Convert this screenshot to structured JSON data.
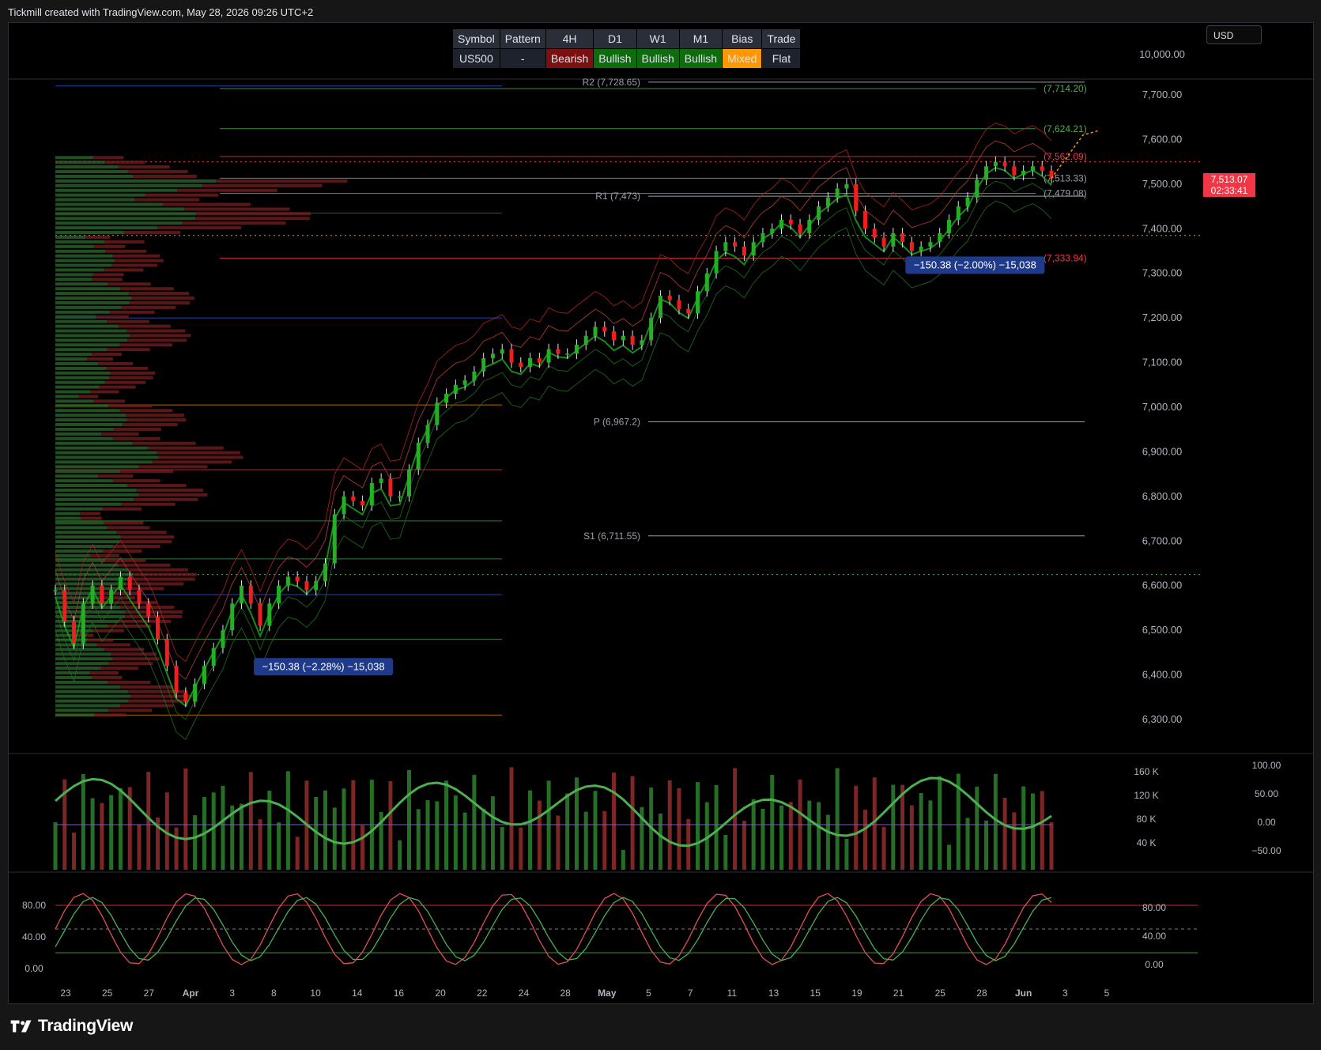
{
  "header": {
    "title": "Tickmill created with TradingView.com, May 28, 2026 09:26 UTC+2"
  },
  "currency": "USD",
  "bias_table": {
    "headers": [
      "Symbol",
      "Pattern",
      "4H",
      "D1",
      "W1",
      "M1",
      "Bias",
      "Trade"
    ],
    "values": [
      "US500",
      "-",
      "Bearish",
      "Bullish",
      "Bullish",
      "Bullish",
      "Mixed",
      "Flat"
    ],
    "colors": [
      "#1e222d",
      "#1e222d",
      "#7a1010",
      "#0e6b0e",
      "#0e6b0e",
      "#0e6b0e",
      "#ff9800",
      "#1e222d"
    ]
  },
  "last_price": {
    "value": "7,513.07",
    "countdown": "02:33:41"
  },
  "footer": {
    "brand": "TradingView"
  },
  "chart_data": [
    {
      "type": "line",
      "symbol": "US500",
      "ylim": [
        6260,
        7760
      ],
      "yticks_main": [
        "7,700.00",
        "7,600.00",
        "7,500.00",
        "7,400.00",
        "7,300.00",
        "7,200.00",
        "7,100.00",
        "7,000.00",
        "6,900.00",
        "6,800.00",
        "6,700.00",
        "6,600.00",
        "6,500.00",
        "6,400.00",
        "6,300.00"
      ],
      "ytick_top": "10,000.00",
      "x_ticks": [
        "23",
        "25",
        "27",
        "Apr",
        "3",
        "8",
        "10",
        "14",
        "16",
        "20",
        "22",
        "24",
        "28",
        "May",
        "5",
        "7",
        "11",
        "13",
        "15",
        "19",
        "21",
        "25",
        "28",
        "Jun",
        "3",
        "5"
      ],
      "series": [
        {
          "values": [
            6590,
            6520,
            6470,
            6560,
            6600,
            6560,
            6590,
            6620,
            6590,
            6560,
            6530,
            6480,
            6420,
            6360,
            6340,
            6380,
            6420,
            6460,
            6500,
            6560,
            6600,
            6560,
            6510,
            6560,
            6600,
            6620,
            6610,
            6590,
            6610,
            6650,
            6760,
            6800,
            6790,
            6780,
            6830,
            6840,
            6800,
            6800,
            6860,
            6920,
            6960,
            7010,
            7030,
            7050,
            7060,
            7080,
            7110,
            7120,
            7130,
            7100,
            7090,
            7110,
            7100,
            7130,
            7120,
            7120,
            7140,
            7160,
            7180,
            7170,
            7150,
            7160,
            7140,
            7150,
            7200,
            7250,
            7240,
            7220,
            7210,
            7260,
            7300,
            7350,
            7370,
            7360,
            7340,
            7370,
            7390,
            7400,
            7420,
            7410,
            7390,
            7420,
            7450,
            7470,
            7490,
            7500,
            7440,
            7400,
            7380,
            7360,
            7390,
            7370,
            7350,
            7360,
            7370,
            7390,
            7420,
            7450,
            7470,
            7510,
            7540,
            7550,
            7540,
            7520,
            7530,
            7540,
            7530,
            7513
          ]
        }
      ],
      "levels": [
        {
          "label": "R2 (7,728.65)",
          "price": 7728.65
        },
        {
          "label": "R1 (7,473)",
          "price": 7473
        },
        {
          "label": "P (6,967.2)",
          "price": 6967.2
        },
        {
          "label": "S1 (6,711.55)",
          "price": 6711.55
        }
      ],
      "right_labels": [
        {
          "label": "(7,714.20)",
          "price": 7714.2
        },
        {
          "label": "(7,624.21)",
          "price": 7624.21
        },
        {
          "label": "(7,562.09)",
          "price": 7562.09
        },
        {
          "label": "(7,513.33)",
          "price": 7513.33
        },
        {
          "label": "(7,479.08)",
          "price": 7479.08
        },
        {
          "label": "(7,333.94)",
          "price": 7333.94
        }
      ],
      "annotations": [
        {
          "label": "−150.38 (−2.28%) −15,038",
          "x_index": 22,
          "price": 6420
        },
        {
          "label": "−150.38 (−2.00%) −15,038",
          "x_index": 92,
          "price": 7320
        }
      ]
    },
    {
      "type": "bar",
      "name_hint": "volume",
      "yticks_left": [
        "160 K",
        "120 K",
        "80 K",
        "40 K"
      ],
      "yticks_right": [
        "100.00",
        "50.00",
        "0.00",
        "−50.00"
      ],
      "ylim": [
        0,
        180000
      ]
    },
    {
      "type": "line",
      "name_hint": "stochastic",
      "yticks_left": [
        "80.00",
        "40.00",
        "0.00"
      ],
      "yticks_right": [
        "80.00",
        "40.00",
        "0.00"
      ],
      "ylim": [
        0,
        100
      ]
    }
  ]
}
